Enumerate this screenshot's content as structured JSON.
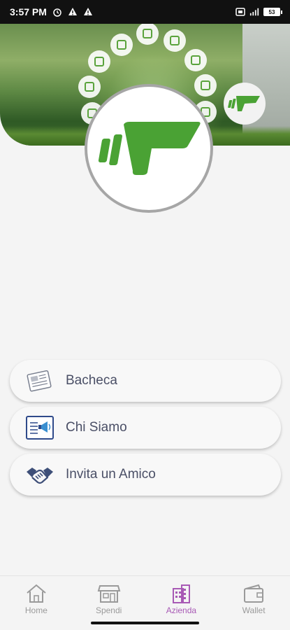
{
  "status_bar": {
    "time": "3:57 PM",
    "battery": "53",
    "icons": [
      "alarm-icon",
      "warning-icon",
      "warning-icon",
      "sim-icon",
      "signal-icon",
      "battery-icon"
    ]
  },
  "menu": {
    "items": [
      {
        "label": "Bacheca",
        "icon": "newspaper-icon"
      },
      {
        "label": "Chi Siamo",
        "icon": "megaphone-board-icon"
      },
      {
        "label": "Invita un Amico",
        "icon": "handshake-icon"
      }
    ]
  },
  "bottom_nav": {
    "items": [
      {
        "label": "Home",
        "icon": "home-icon",
        "active": false
      },
      {
        "label": "Spendi",
        "icon": "shop-icon",
        "active": false
      },
      {
        "label": "Azienda",
        "icon": "building-icon",
        "active": true
      },
      {
        "label": "Wallet",
        "icon": "wallet-icon",
        "active": false
      }
    ]
  },
  "colors": {
    "brand_green": "#4aa234",
    "active_nav": "#a85ab5",
    "text": "#4a4f66"
  }
}
